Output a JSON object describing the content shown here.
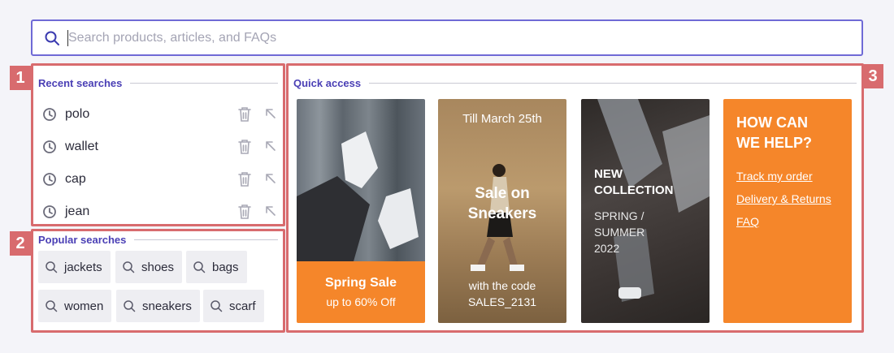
{
  "search": {
    "placeholder": "Search products, articles, and FAQs",
    "value": ""
  },
  "badges": [
    "1",
    "2",
    "3"
  ],
  "recent": {
    "title": "Recent searches",
    "items": [
      {
        "label": "polo"
      },
      {
        "label": "wallet"
      },
      {
        "label": "cap"
      },
      {
        "label": "jean"
      }
    ]
  },
  "popular": {
    "title": "Popular searches",
    "items": [
      {
        "label": "jackets"
      },
      {
        "label": "shoes"
      },
      {
        "label": "bags"
      },
      {
        "label": "women"
      },
      {
        "label": "sneakers"
      },
      {
        "label": "scarf"
      }
    ]
  },
  "quick": {
    "title": "Quick access",
    "cards": [
      {
        "title": "Spring Sale",
        "subtitle": "up to 60% Off"
      },
      {
        "top": "Till March 25th",
        "title_line1": "Sale on",
        "title_line2": "Sneakers",
        "bottom_line1": "with the code",
        "bottom_line2": "SALES_2131"
      },
      {
        "title_line1": "NEW",
        "title_line2": "COLLECTION",
        "sub_line1": "SPRING /",
        "sub_line2": "SUMMER",
        "sub_line3": "2022"
      },
      {
        "title_line1": "HOW CAN",
        "title_line2": "WE HELP?",
        "links": [
          "Track my order",
          "Delivery & Returns",
          "FAQ"
        ]
      }
    ]
  },
  "colors": {
    "accent": "#4a3fb5",
    "annotation": "#d86b6e",
    "orange": "#f5862a"
  }
}
